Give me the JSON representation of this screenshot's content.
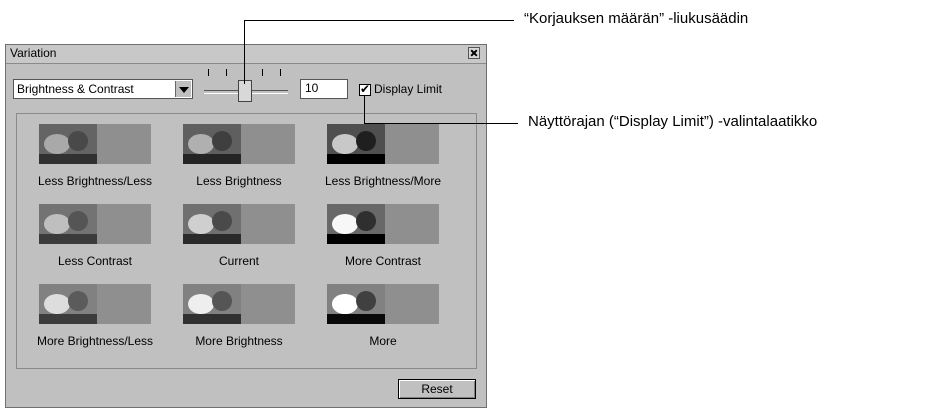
{
  "window": {
    "title": "Variation",
    "close_icon": "close-icon"
  },
  "controls": {
    "selected_option": "Brightness & Contrast",
    "correction_amount": "10",
    "display_limit_label": "Display Limit",
    "display_limit_checked": true,
    "slider_position_fraction": 0.45
  },
  "variations": [
    {
      "label": "Less Brightness/Less"
    },
    {
      "label": "Less Brightness"
    },
    {
      "label": "Less Brightness/More"
    },
    {
      "label": "Less Contrast"
    },
    {
      "label": "Current"
    },
    {
      "label": "More Contrast"
    },
    {
      "label": "More Brightness/Less"
    },
    {
      "label": "More Brightness"
    },
    {
      "label": "More"
    }
  ],
  "buttons": {
    "reset_label": "Reset"
  },
  "callouts": {
    "slider": "“Korjauksen määrän” -liukusäädin",
    "checkbox": "Näyttörajan (“Display Limit”) -valintalaatikko"
  }
}
